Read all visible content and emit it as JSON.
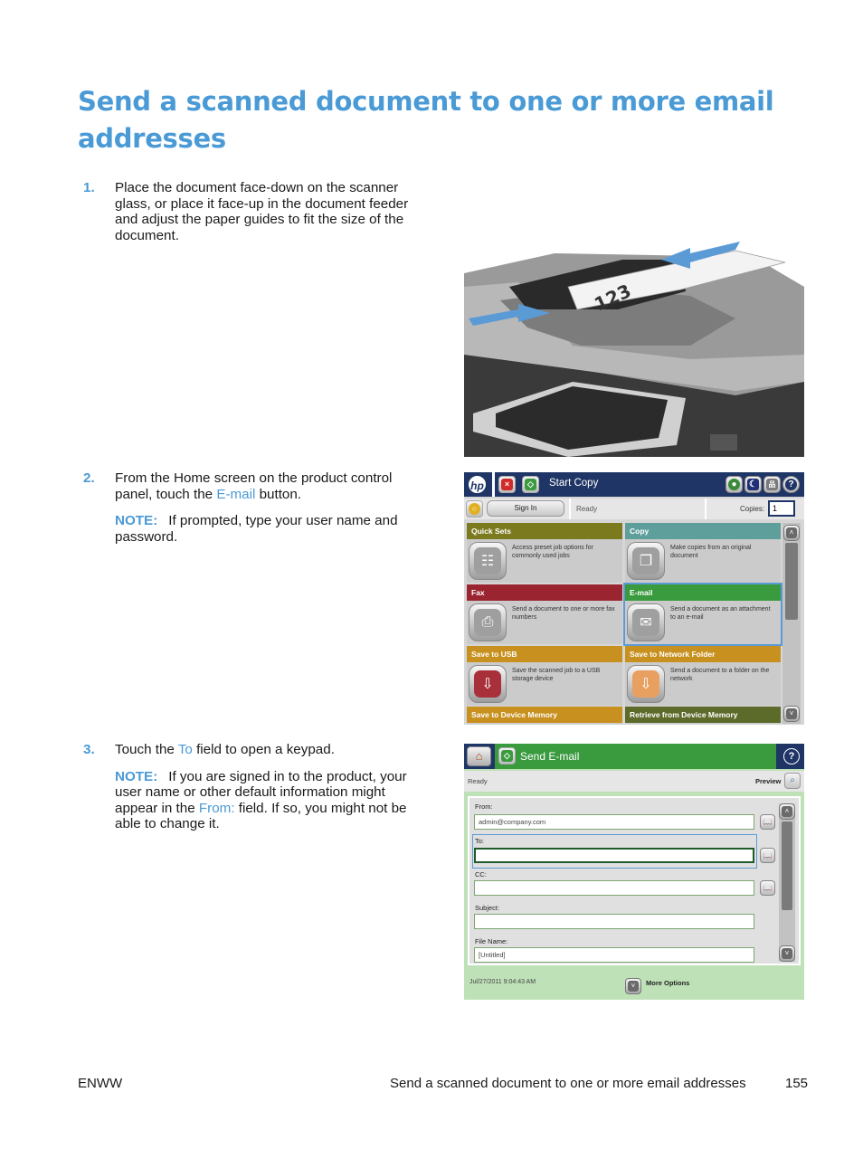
{
  "page": {
    "title": "Send a scanned document to one or more email addresses",
    "accent_color": "#4a9ad6"
  },
  "steps": [
    {
      "number": "1.",
      "text": "Place the document face-down on the scanner glass, or place it face-up in the document feeder and adjust the paper guides to fit the size of the document."
    },
    {
      "number": "2.",
      "text_before": "From the Home screen on the product control panel, touch the ",
      "link": "E-mail",
      "text_after": " button.",
      "note_label": "NOTE:",
      "note": "If prompted, type your user name and password."
    },
    {
      "number": "3.",
      "text_before": "Touch the ",
      "link": "To",
      "text_after": " field to open a keypad.",
      "note_label": "NOTE:",
      "note_before": "If you are signed in to the product, your user name or other default information might appear in the ",
      "note_link": "From:",
      "note_after": " field. If so, you might not be able to change it."
    }
  ],
  "figure1": {
    "description": "Scanner document feeder with paper labeled 123 and blue arrows",
    "paper_label": "123"
  },
  "home_screen": {
    "logo": "hp",
    "title": "Start Copy",
    "sign_in": "Sign In",
    "status": "Ready",
    "copies_label": "Copies:",
    "copies_value": "1",
    "icons": [
      "stop-icon",
      "start-icon",
      "globe-icon",
      "sleep-icon",
      "network-icon",
      "help-icon"
    ],
    "tiles": [
      {
        "label": "Quick Sets",
        "desc": "Access preset job options for commonly used jobs",
        "color": "#7c7a1f",
        "icon": "clipboard-icon"
      },
      {
        "label": "Copy",
        "desc": "Make copies from an original document",
        "color": "#5e9e9b",
        "icon": "copy-icon"
      },
      {
        "label": "Fax",
        "desc": "Send a document to one or more fax numbers",
        "color": "#9a2530",
        "icon": "fax-icon"
      },
      {
        "label": "E-mail",
        "desc": "Send a document as an attachment to an e-mail",
        "color": "#3a9a3e",
        "icon": "envelope-icon",
        "selected": true
      },
      {
        "label": "Save to USB",
        "desc": "Save the scanned job to a USB storage device",
        "color": "#c7901f",
        "icon": "usb-icon"
      },
      {
        "label": "Save to Network Folder",
        "desc": "Send a document to a folder on the network",
        "color": "#c7901f",
        "icon": "folder-icon"
      },
      {
        "label": "Save to Device Memory",
        "desc": "",
        "color": "#c7901f",
        "icon": ""
      },
      {
        "label": "Retrieve from Device Memory",
        "desc": "",
        "color": "#5c6a2a",
        "icon": ""
      }
    ]
  },
  "email_screen": {
    "title": "Send E-mail",
    "status": "Ready",
    "preview_label": "Preview",
    "fields": [
      {
        "label": "From:",
        "value": "admin@company.com",
        "has_book": true
      },
      {
        "label": "To:",
        "value": "",
        "has_book": true,
        "active": true
      },
      {
        "label": "CC:",
        "value": "",
        "has_book": true
      },
      {
        "label": "Subject:",
        "value": "",
        "has_book": false
      },
      {
        "label": "File Name:",
        "value": "[Untitled]",
        "has_book": false
      }
    ],
    "timestamp": "Jul/27/2011 9:04:43 AM",
    "more_options": "More Options"
  },
  "footer": {
    "left": "ENWW",
    "section": "Send a scanned document to one or more email addresses",
    "page_number": "155"
  }
}
